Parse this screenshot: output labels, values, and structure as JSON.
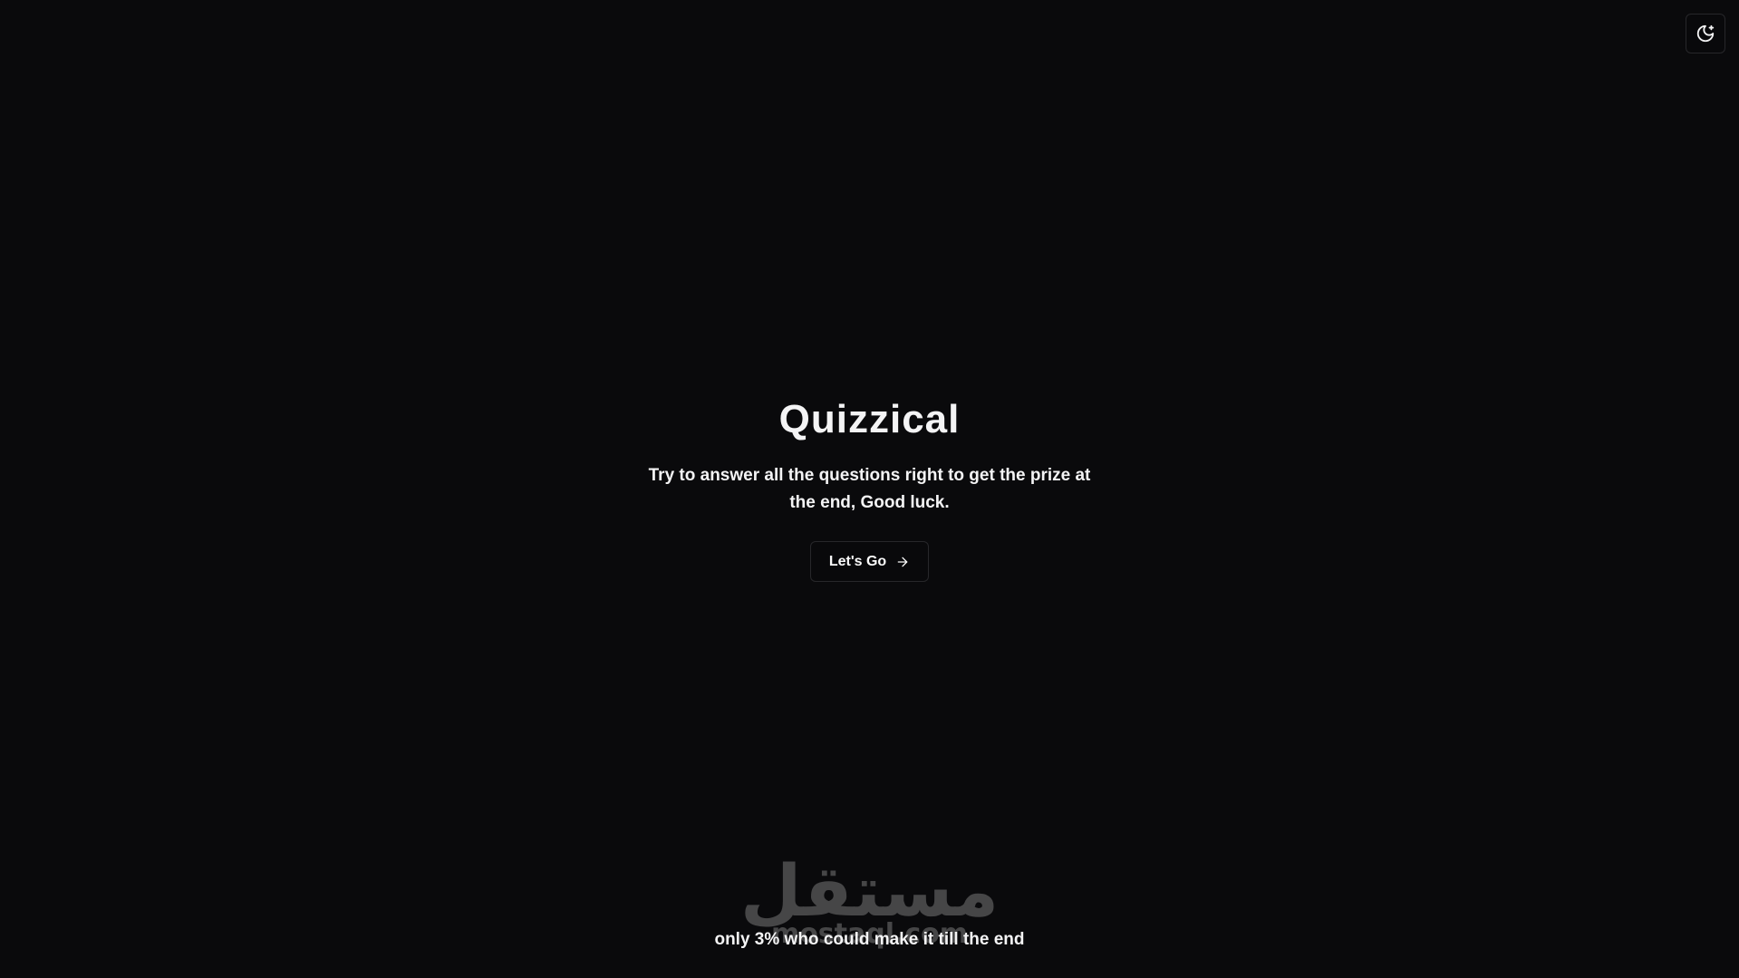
{
  "header": {
    "theme_toggle_icon": "moon-stars-icon"
  },
  "hero": {
    "title": "Quizzical",
    "subtitle": "Try to answer all the questions right to get the prize at the end, Good luck.",
    "cta_label": "Let's Go",
    "cta_icon": "arrow-right-icon"
  },
  "watermark": {
    "logo_text": "مستقل",
    "domain_text": "mostaql.com"
  },
  "footer": {
    "note": "only 3% who could make it till the end"
  },
  "colors": {
    "background": "#0a0a0c",
    "text": "#f4f4f5",
    "border": "#27272a"
  }
}
